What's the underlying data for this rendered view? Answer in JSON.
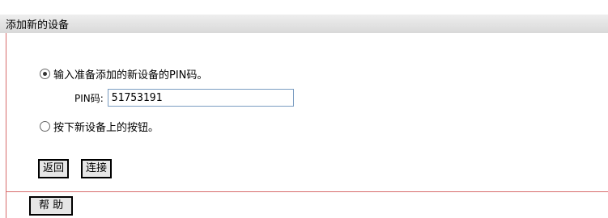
{
  "header": {
    "title": "添加新的设备"
  },
  "options": [
    {
      "label": "输入准备添加的新设备的PIN码。",
      "checked": true
    },
    {
      "label": "按下新设备上的按钮。",
      "checked": false
    }
  ],
  "pin": {
    "label": "PIN码:",
    "value": "51753191"
  },
  "buttons": {
    "back": "返回",
    "connect": "连接",
    "help": "帮 助"
  }
}
